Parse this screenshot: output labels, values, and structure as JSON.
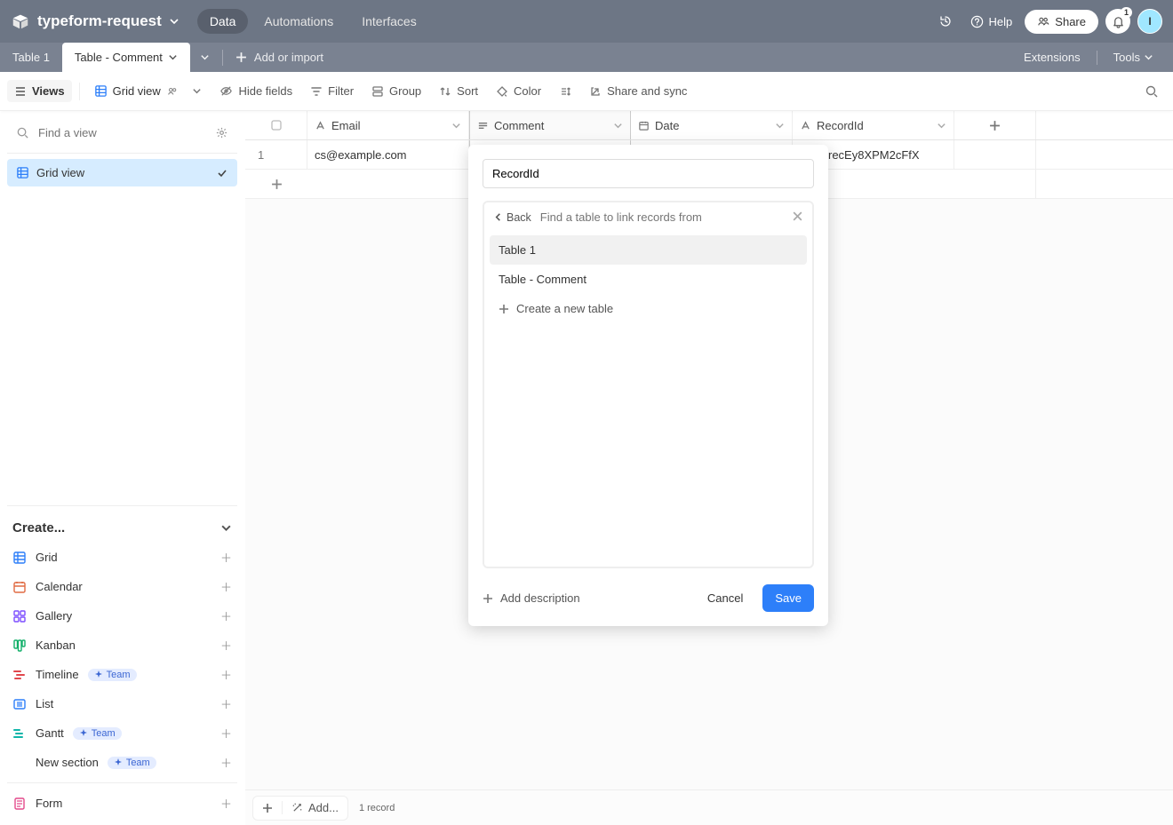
{
  "header": {
    "base_name": "typeform-request",
    "tabs": {
      "data": "Data",
      "automations": "Automations",
      "interfaces": "Interfaces"
    },
    "help": "Help",
    "share": "Share",
    "notif_count": "1",
    "avatar_initial": "I"
  },
  "table_tabs": {
    "tab1": "Table 1",
    "tab2": "Table - Comment",
    "add_or_import": "Add or import",
    "extensions": "Extensions",
    "tools": "Tools"
  },
  "viewbar": {
    "views": "Views",
    "grid_view": "Grid view",
    "hide_fields": "Hide fields",
    "filter": "Filter",
    "group": "Group",
    "sort": "Sort",
    "color": "Color",
    "share_sync": "Share and sync"
  },
  "sidebar": {
    "find_placeholder": "Find a view",
    "active_view": "Grid view",
    "create_header": "Create...",
    "items": {
      "grid": "Grid",
      "calendar": "Calendar",
      "gallery": "Gallery",
      "kanban": "Kanban",
      "timeline": "Timeline",
      "list": "List",
      "gantt": "Gantt",
      "new_section": "New section",
      "form": "Form"
    },
    "team_badge": "Team"
  },
  "grid": {
    "columns": {
      "email": "Email",
      "comment": "Comment",
      "date": "Date",
      "recordid": "RecordId"
    },
    "rows": [
      {
        "n": "1",
        "email": "cs@example.com",
        "comment": "",
        "date": "",
        "recordid": "recEy8XPM2cFfX"
      }
    ],
    "add_label": "Add...",
    "record_count": "1 record"
  },
  "popover": {
    "field_name_value": "RecordId",
    "back": "Back",
    "search_placeholder": "Find a table to link records from",
    "option1": "Table 1",
    "option2": "Table - Comment",
    "create_new": "Create a new table",
    "add_description": "Add description",
    "cancel": "Cancel",
    "save": "Save"
  }
}
